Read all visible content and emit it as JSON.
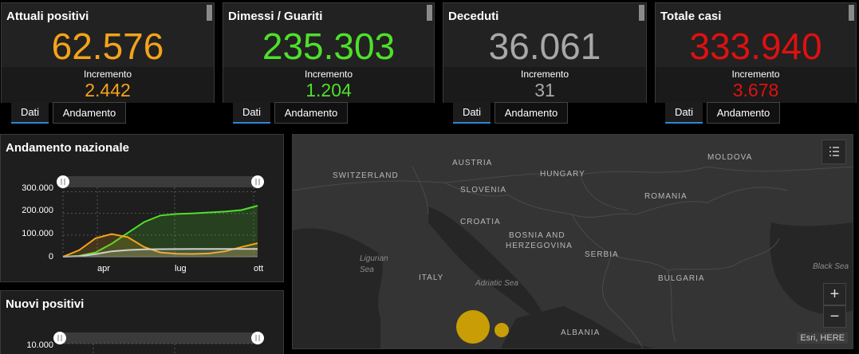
{
  "stats": [
    {
      "title": "Attuali positivi",
      "value": "62.576",
      "inc_label": "Incremento",
      "inc_value": "2.442",
      "color": "#f5a31a"
    },
    {
      "title": "Dimessi / Guariti",
      "value": "235.303",
      "inc_label": "Incremento",
      "inc_value": "1.204",
      "color": "#4ee02b"
    },
    {
      "title": "Deceduti",
      "value": "36.061",
      "inc_label": "Incremento",
      "inc_value": "31",
      "color": "#a8a8a8"
    },
    {
      "title": "Totale casi",
      "value": "333.940",
      "inc_label": "Incremento",
      "inc_value": "3.678",
      "color": "#e01010"
    }
  ],
  "tabs": {
    "dati": "Dati",
    "andamento": "Andamento"
  },
  "trend": {
    "title": "Andamento nazionale",
    "chart_data": {
      "type": "line",
      "x": [
        "apr",
        "lug",
        "ott"
      ],
      "y_ticks": [
        "300.000",
        "200.000",
        "100.000",
        "0"
      ],
      "ylim": [
        0,
        320000
      ],
      "series": [
        {
          "color": "#4ee02b",
          "values": [
            0,
            4000,
            20000,
            60000,
            110000,
            160000,
            190000,
            197000,
            200000,
            204000,
            208000,
            215000,
            235303
          ]
        },
        {
          "color": "#f5a31a",
          "values": [
            0,
            30000,
            85000,
            105000,
            90000,
            45000,
            20000,
            14000,
            13000,
            15000,
            25000,
            45000,
            62576
          ]
        },
        {
          "color": "#cfcfcf",
          "values": [
            0,
            2000,
            12000,
            25000,
            31000,
            34000,
            35000,
            35300,
            35500,
            35700,
            35800,
            35900,
            36061
          ]
        }
      ]
    }
  },
  "nuovi": {
    "title": "Nuovi positivi",
    "y_tick": "10.000"
  },
  "map": {
    "countries": [
      "AUSTRIA",
      "HUNGARY",
      "MOLDOVA",
      "SWITZERLAND",
      "SLOVENIA",
      "ROMANIA",
      "CROATIA",
      "BOSNIA AND",
      "HERZEGOVINA",
      "SERBIA",
      "ITALY",
      "BULGARIA",
      "ALBANIA"
    ],
    "seas": [
      "Ligurian",
      "Sea",
      "Adriatic Sea",
      "Black Sea"
    ],
    "attribution": "Esri, HERE",
    "zoom_in": "+",
    "zoom_out": "−"
  }
}
